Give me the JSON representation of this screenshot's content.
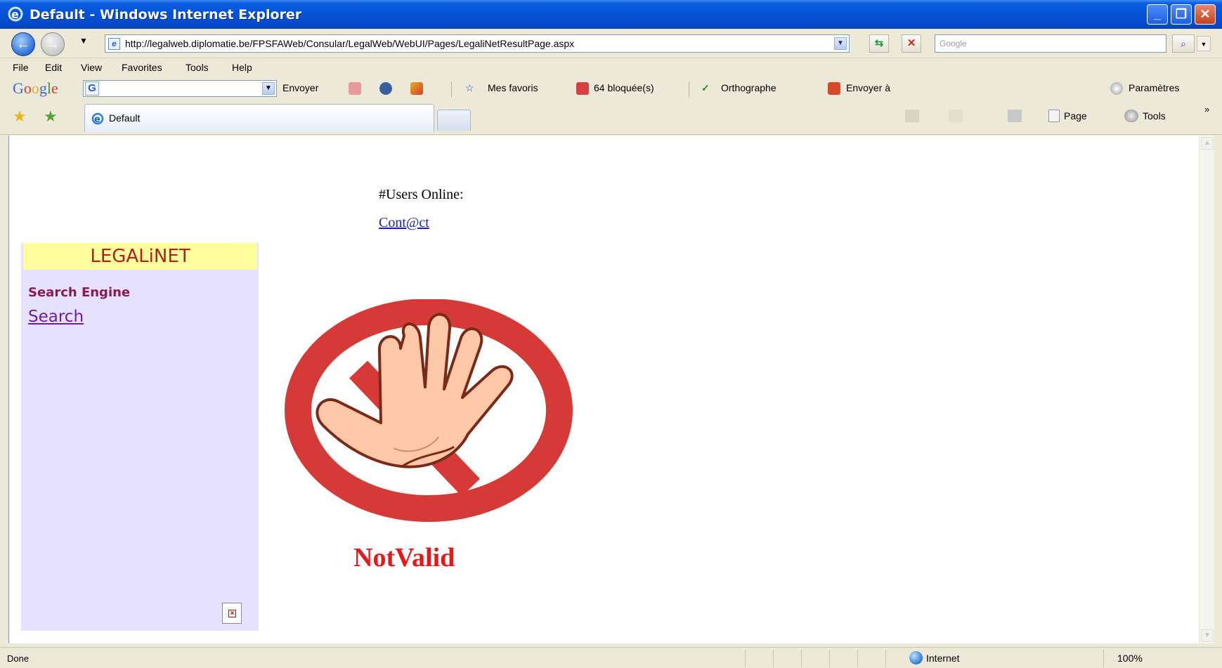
{
  "window": {
    "title": "Default - Windows Internet Explorer"
  },
  "address": {
    "url": "http://legalweb.diplomatie.be/FPSFAWeb/Consular/LegalWeb/WebUI/Pages/LegaliNetResultPage.aspx"
  },
  "search": {
    "placeholder": "Google"
  },
  "menu": {
    "file": "File",
    "edit": "Edit",
    "view": "View",
    "favorites": "Favorites",
    "tools": "Tools",
    "help": "Help"
  },
  "google_toolbar": {
    "logo": "Google",
    "send": "Envoyer",
    "favorites": "Mes favoris",
    "blocked": "64 bloquée(s)",
    "spelling": "Orthographe",
    "send_to": "Envoyer à",
    "settings": "Paramètres"
  },
  "tabs": [
    {
      "label": "Default"
    }
  ],
  "commands": {
    "page": "Page",
    "tools": "Tools"
  },
  "page": {
    "users_online": "#Users Online:",
    "contact": "Cont@ct",
    "brand": "LEGALiNET",
    "section_title": "Search Engine",
    "search_link": "Search",
    "result": "NotValid"
  },
  "status": {
    "text": "Done",
    "zone": "Internet",
    "zoom": "100%"
  },
  "colors": {
    "brand_bg": "#ffff9c",
    "sidebar_bg": "#e6e1ff",
    "notvalid": "#e11b1b",
    "titlebar": "#0553d6"
  }
}
